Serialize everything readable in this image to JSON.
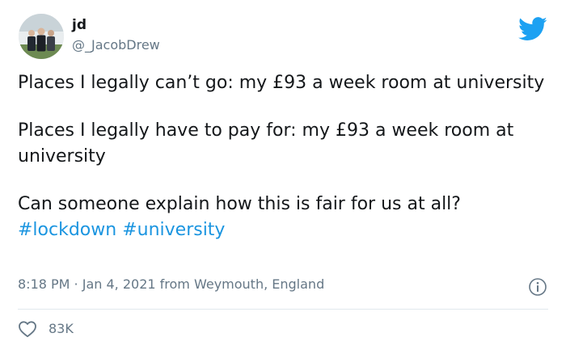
{
  "author": {
    "display_name": "jd",
    "handle": "@_JacobDrew",
    "avatar_icon": "avatar-photo"
  },
  "tweet": {
    "line1": "Places I legally can’t go: my £93 a week room at university",
    "line2": "Places I legally have to pay for: my £93 a week room at university",
    "line3": "Can someone explain how this is fair for us at all?",
    "hashtags": [
      "#lockdown",
      "#university"
    ]
  },
  "meta": {
    "time": "8:18 PM",
    "separator": " · ",
    "date": "Jan 4, 2021",
    "location": " from Weymouth, England"
  },
  "stats": {
    "likes": "83K"
  },
  "colors": {
    "brand": "#1da1f2",
    "hashtag": "#1b95e0",
    "secondary_text": "#657786",
    "divider": "#e1e8ed"
  },
  "icons": {
    "brand": "twitter-bird-icon",
    "info": "info-icon",
    "like": "heart-icon"
  }
}
